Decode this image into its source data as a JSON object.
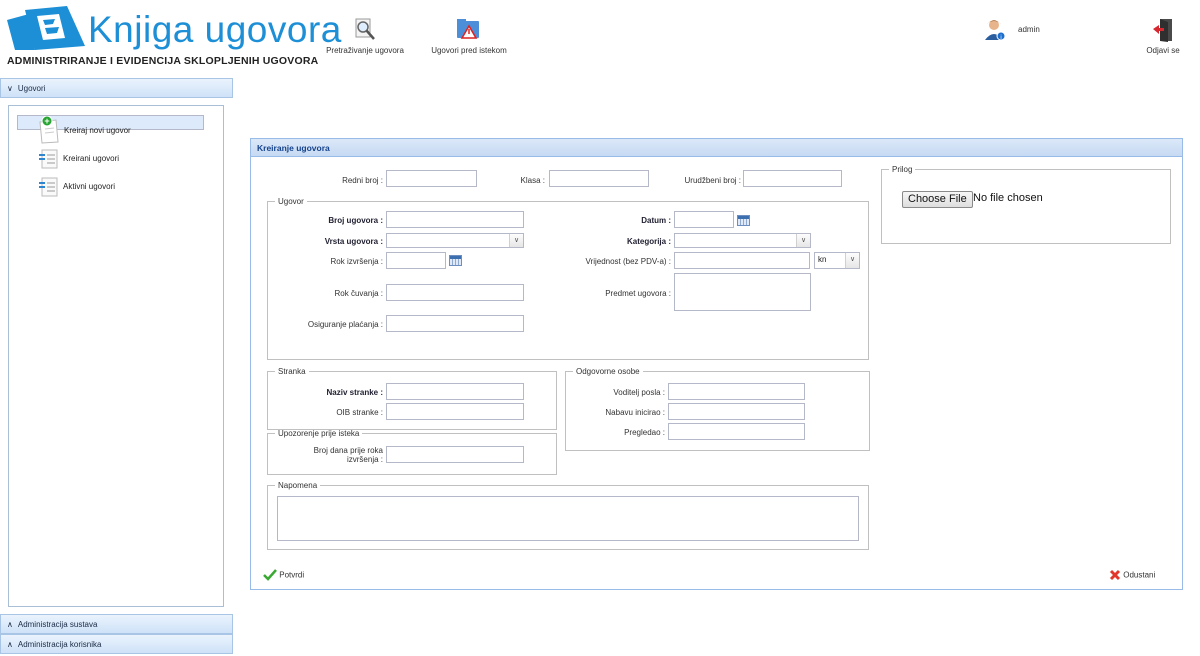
{
  "header": {
    "app_title": "Knjiga ugovora",
    "app_subtitle": "ADMINISTRIRANJE I EVIDENCIJA SKLOPLJENIH UGOVORA",
    "toolbar": {
      "search_contracts": "Pretraživanje ugovora",
      "expiring_contracts": "Ugovori pred istekom"
    },
    "user": "admin",
    "logout": "Odjavi se"
  },
  "sidebar": {
    "sections": [
      {
        "label": "Ugovori",
        "expanded": true
      },
      {
        "label": "Administracija sustava",
        "expanded": false
      },
      {
        "label": "Administracija korisnika",
        "expanded": false
      }
    ],
    "items": [
      {
        "label": "Kreiraj novi ugovor",
        "selected": true
      },
      {
        "label": "Kreirani ugovori"
      },
      {
        "label": "Aktivni ugovori"
      }
    ]
  },
  "form": {
    "title": "Kreiranje ugovora",
    "top": {
      "redni_broj": "Redni broj :",
      "klasa": "Klasa :",
      "urudzbeni_broj": "Urudžbeni broj :"
    },
    "ugovor": {
      "legend": "Ugovor",
      "broj_ugovora": "Broj ugovora :",
      "vrsta_ugovora": "Vrsta ugovora :",
      "rok_izvrsenja": "Rok izvršenja :",
      "rok_cuvanja": "Rok čuvanja :",
      "osiguranje_placanja": "Osiguranje plaćanja :",
      "datum": "Datum :",
      "kategorija": "Kategorija :",
      "vrijednost": "Vrijednost (bez PDV-a) :",
      "currency": "kn",
      "predmet_ugovora": "Predmet ugovora :"
    },
    "stranka": {
      "legend": "Stranka",
      "naziv_stranke": "Naziv stranke :",
      "oib_stranke": "OIB stranke :"
    },
    "upozorenje": {
      "legend": "Upozorenje prije isteka",
      "broj_dana_1": "Broj dana prije roka",
      "broj_dana_2": "izvršenja :"
    },
    "odgovorne": {
      "legend": "Odgovorne osobe",
      "voditelj_posla": "Voditelj posla :",
      "nabavu_inicirao": "Nabavu inicirao :",
      "pregledao": "Pregledao :"
    },
    "napomena": {
      "legend": "Napomena"
    },
    "prilog": {
      "legend": "Prilog",
      "choose_file": "Choose File",
      "no_file": "No file chosen"
    },
    "actions": {
      "confirm": "Potvrdi",
      "cancel": "Odustani"
    }
  }
}
